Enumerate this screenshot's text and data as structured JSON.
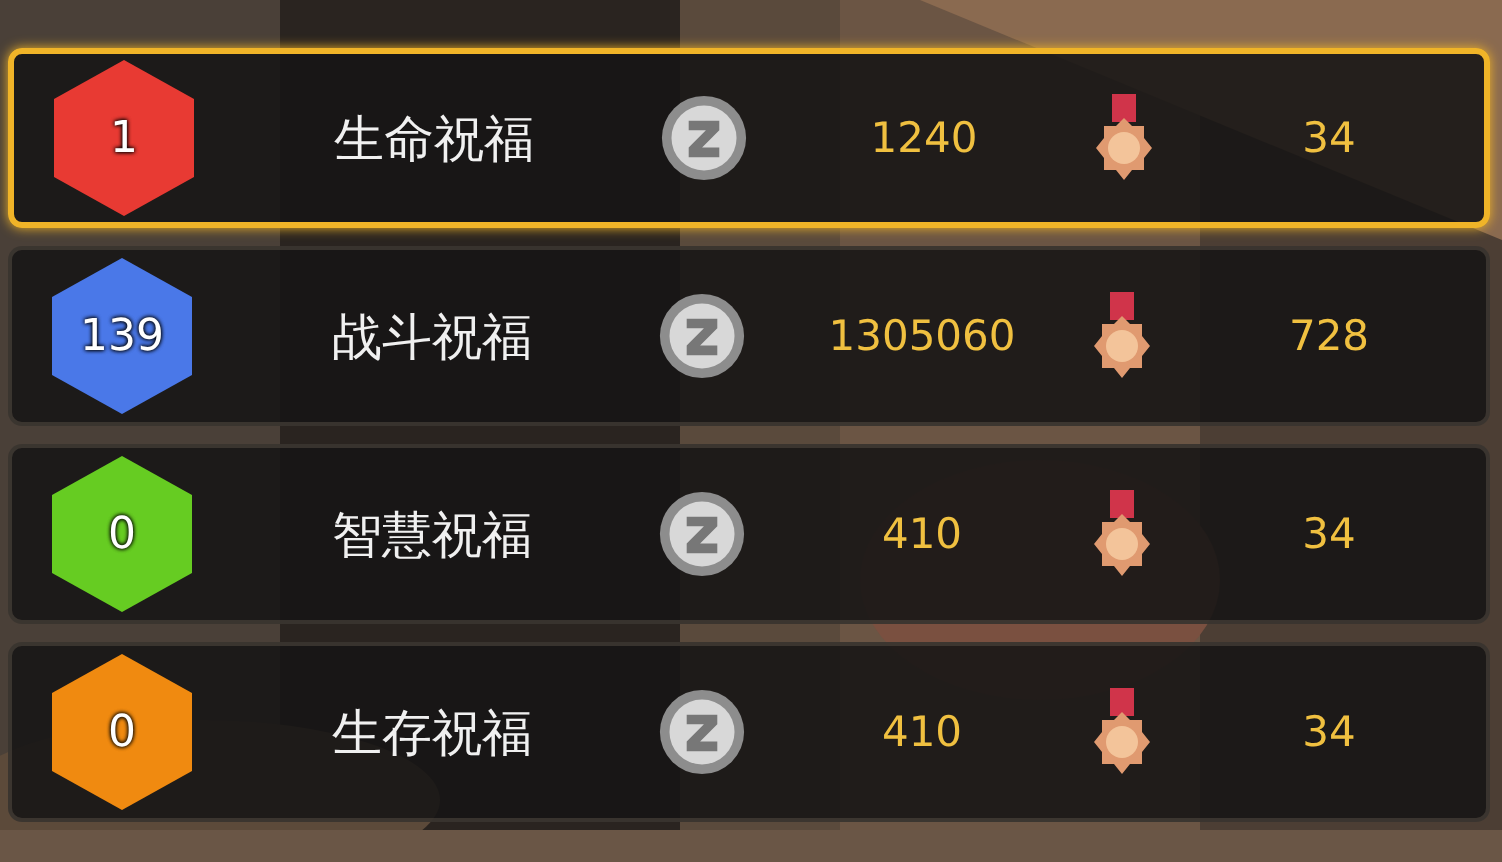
{
  "rows": [
    {
      "rank": "1",
      "color": "#e83a33",
      "name": "生命祝福",
      "value": "1240",
      "count": "34",
      "selected": true
    },
    {
      "rank": "139",
      "color": "#4a78e8",
      "name": "战斗祝福",
      "value": "1305060",
      "count": "728",
      "selected": false
    },
    {
      "rank": "0",
      "color": "#66cc22",
      "name": "智慧祝福",
      "value": "410",
      "count": "34",
      "selected": false
    },
    {
      "rank": "0",
      "color": "#f08a10",
      "name": "生存祝福",
      "value": "410",
      "count": "34",
      "selected": false
    }
  ]
}
